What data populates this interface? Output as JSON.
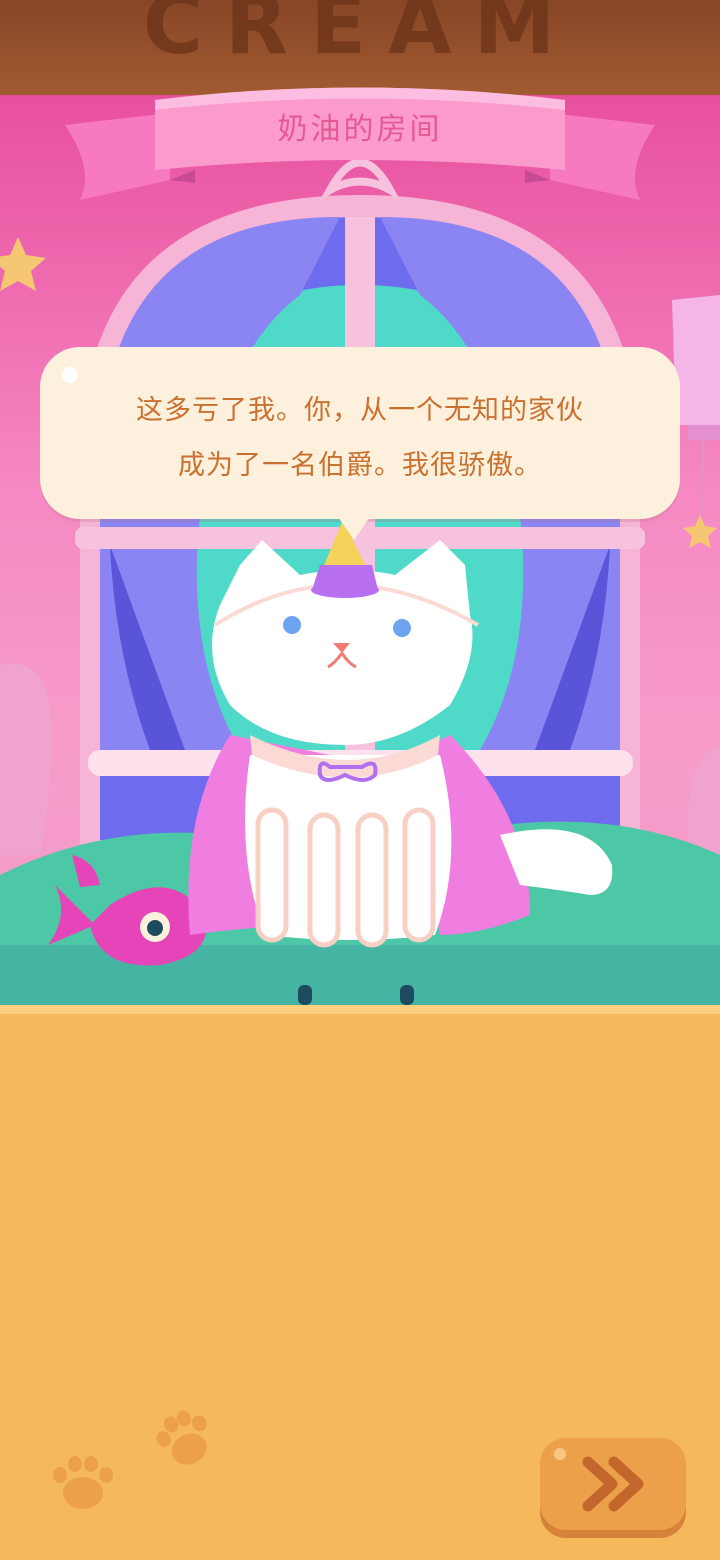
{
  "game": {
    "sign_text": "CREAM",
    "room_title": "奶油的房间",
    "dialogue": {
      "line1": "这多亏了我。你，从一个无知的家伙",
      "line2": "成为了一名伯爵。我很骄傲。"
    },
    "next_button": {
      "icon": "double-chevron-right-icon"
    }
  },
  "colors": {
    "sign_brown": "#874627",
    "room_pink": "#f68ac4",
    "ribbon_pink": "#fb9bcd",
    "bubble_cream": "#fdf0dd",
    "text_orange": "#c9712f",
    "panel_orange": "#f5b85a",
    "button_orange": "#eda04a"
  }
}
